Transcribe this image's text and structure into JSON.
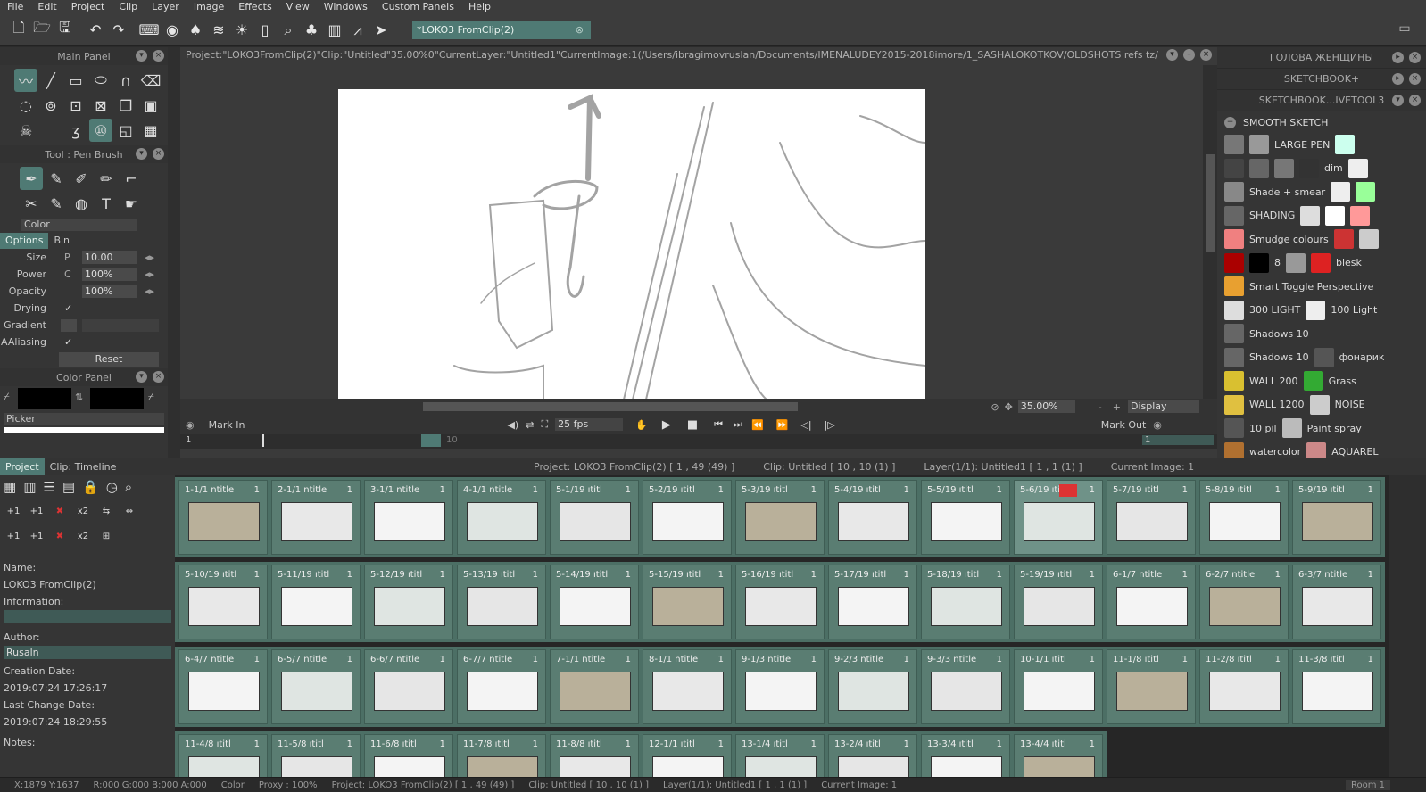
{
  "menu": [
    "File",
    "Edit",
    "Project",
    "Clip",
    "Layer",
    "Image",
    "Effects",
    "View",
    "Windows",
    "Custom Panels",
    "Help"
  ],
  "toolbar": {
    "doc_tab": "*LOKO3 FromClip(2)",
    "close": "⊗"
  },
  "main_panel": {
    "title": "Main Panel"
  },
  "tool_panel": {
    "title": "Tool : Pen Brush",
    "color_label": "Color",
    "tabs": [
      "Options",
      "Bin"
    ],
    "options": [
      {
        "label": "Size",
        "mini": "P",
        "value": "10.00"
      },
      {
        "label": "Power",
        "mini": "C",
        "value": "100%"
      },
      {
        "label": "Opacity",
        "mini": "",
        "value": "100%"
      },
      {
        "label": "Drying",
        "check": "✓"
      },
      {
        "label": "Gradient"
      },
      {
        "label": "AAliasing",
        "check": "✓"
      }
    ],
    "reset": "Reset"
  },
  "color_panel": {
    "title": "Color Panel",
    "picker": "Picker"
  },
  "viewer": {
    "path": "Project:\"LOKO3FromClip(2)\"Clip:\"Untitled\"35.00%0\"CurrentLayer:\"Untitled1\"CurrentImage:1(/Users/ibragimovruslan/Documents/IMENALUDEY2015-2018imore/1_SASHALOKOTKOV/OLDSHOTS refs tz/",
    "zoom": "35.00%",
    "display": "Display",
    "mark_in": "Mark In",
    "mark_out": "Mark Out",
    "fps": "25 fps",
    "frame_start": "1",
    "frame_end": "1",
    "tick_10": "10"
  },
  "right_panel": {
    "headers": [
      "ГОЛОВА ЖЕНЩИНЫ",
      "SKETCHBOOK+",
      "SKETCHBOOK...IVETOOL3"
    ],
    "group": "SMOOTH SKETCH",
    "presets": [
      {
        "items": [
          {
            "c": "#777"
          },
          {
            "c": "#999"
          },
          {
            "t": "LARGE PEN"
          },
          {
            "c": "#cfe"
          }
        ]
      },
      {
        "items": [
          {
            "c": "#444"
          },
          {
            "c": "#666"
          },
          {
            "c": "#777"
          },
          {
            "c": "#333"
          },
          {
            "t": "dim"
          },
          {
            "c": "#eee"
          }
        ]
      },
      {
        "items": [
          {
            "c": "#888"
          },
          {
            "t": "Shade + smear"
          },
          {
            "c": "#eee"
          },
          {
            "c": "#9f9"
          }
        ]
      },
      {
        "items": [
          {
            "c": "#666"
          },
          {
            "t": "SHADING"
          },
          {
            "c": "#ddd"
          },
          {
            "c": "#fff"
          },
          {
            "c": "#f99"
          }
        ]
      },
      {
        "items": [
          {
            "c": "#f08080"
          },
          {
            "t": "Smudge colours"
          },
          {
            "c": "#c33"
          },
          {
            "c": "#ccc"
          }
        ]
      },
      {
        "items": [
          {
            "c": "#a00"
          },
          {
            "c": "#000"
          },
          {
            "t": "8"
          },
          {
            "c": "#999"
          },
          {
            "c": "#d22"
          },
          {
            "t": "blesk"
          }
        ]
      },
      {
        "items": [
          {
            "c": "#e8a030"
          },
          {
            "t": "Smart Toggle Perspective"
          }
        ]
      },
      {
        "items": [
          {
            "c": "#ddd"
          },
          {
            "t": "300 LIGHT"
          },
          {
            "c": "#eee"
          },
          {
            "t": "100 Light"
          }
        ]
      },
      {
        "items": [
          {
            "c": "#666"
          },
          {
            "t": "Shadows 10"
          }
        ]
      },
      {
        "items": [
          {
            "c": "#666"
          },
          {
            "t": "Shadows 10"
          },
          {
            "c": "#555"
          },
          {
            "t": "фонарик"
          }
        ]
      },
      {
        "items": [
          {
            "c": "#d9c030"
          },
          {
            "t": "WALL 200"
          },
          {
            "c": "#3a3"
          },
          {
            "t": "Grass"
          }
        ]
      },
      {
        "items": [
          {
            "c": "#e0c040"
          },
          {
            "t": "WALL 1200"
          },
          {
            "c": "#ccc"
          },
          {
            "t": "NOISE"
          }
        ]
      },
      {
        "items": [
          {
            "c": "#555"
          },
          {
            "t": "10 pil"
          },
          {
            "c": "#bbb"
          },
          {
            "t": "Paint spray"
          }
        ]
      },
      {
        "items": [
          {
            "c": "#b07030"
          },
          {
            "t": "watercolor"
          },
          {
            "c": "#c88"
          },
          {
            "t": "AQUAREL"
          }
        ]
      }
    ]
  },
  "bottom": {
    "tabs": [
      "Project",
      "Clip: Timeline"
    ],
    "info": [
      "Project: LOKO3 FromClip(2) [ 1 , 49  (49) ]",
      "Clip: Untitled [ 10 , 10  (1) ]",
      "Layer(1/1): Untitled1 [ 1 , 1  (1) ]",
      "Current Image: 1"
    ]
  },
  "project_panel": {
    "name_label": "Name:",
    "name": "LOKO3 FromClip(2)",
    "info_label": "Information:",
    "author_label": "Author:",
    "author": "Rusaln",
    "created_label": "Creation Date:",
    "created": "2019:07:24 17:26:17",
    "changed_label": "Last Change Date:",
    "changed": "2019:07:24 18:29:55",
    "notes_label": "Notes:"
  },
  "clips": [
    [
      "1-1/1  ntitle",
      "2-1/1  ntitle",
      "3-1/1  ntitle",
      "4-1/1  ntitle",
      "5-1/19  ıtitl",
      "5-2/19  ıtitl",
      "5-3/19  ıtitl",
      "5-4/19  ıtitl",
      "5-5/19  ıtitl",
      "5-6/19  ıtitl",
      "5-7/19  ıtitl",
      "5-8/19  ıtitl",
      "5-9/19  ıtitl"
    ],
    [
      "5-10/19  ıtitl",
      "5-11/19  ıtitl",
      "5-12/19  ıtitl",
      "5-13/19  ıtitl",
      "5-14/19  ıtitl",
      "5-15/19  ıtitl",
      "5-16/19  ıtitl",
      "5-17/19  ıtitl",
      "5-18/19  ıtitl",
      "5-19/19  ıtitl",
      "6-1/7  ntitle",
      "6-2/7  ntitle",
      "6-3/7  ntitle"
    ],
    [
      "6-4/7  ntitle",
      "6-5/7  ntitle",
      "6-6/7  ntitle",
      "6-7/7  ntitle",
      "7-1/1  ntitle",
      "8-1/1  ntitle",
      "9-1/3  ntitle",
      "9-2/3  ntitle",
      "9-3/3  ntitle",
      "10-1/1  ıtitl",
      "11-1/8  ıtitl",
      "11-2/8  ıtitl",
      "11-3/8  ıtitl"
    ],
    [
      "11-4/8  ıtitl",
      "11-5/8  ıtitl",
      "11-6/8  ıtitl",
      "11-7/8  ıtitl",
      "11-8/8  ıtitl",
      "12-1/1  ıtitl",
      "13-1/4  ıtitl",
      "13-2/4  ıtitl",
      "13-3/4  ıtitl",
      "13-4/4  ıtitl"
    ]
  ],
  "clip_count": "1",
  "status": {
    "coords": "X:1879  Y:1637",
    "rgba": "R:000 G:000 B:000 A:000",
    "color": "Color",
    "proxy": "Proxy : 100%",
    "project": "Project: LOKO3 FromClip(2) [ 1 , 49  (49) ]",
    "clip": "Clip: Untitled [ 10 , 10  (1) ]",
    "layer": "Layer(1/1): Untitled1 [ 1 , 1  (1) ]",
    "image": "Current Image: 1",
    "room": "Room 1"
  }
}
